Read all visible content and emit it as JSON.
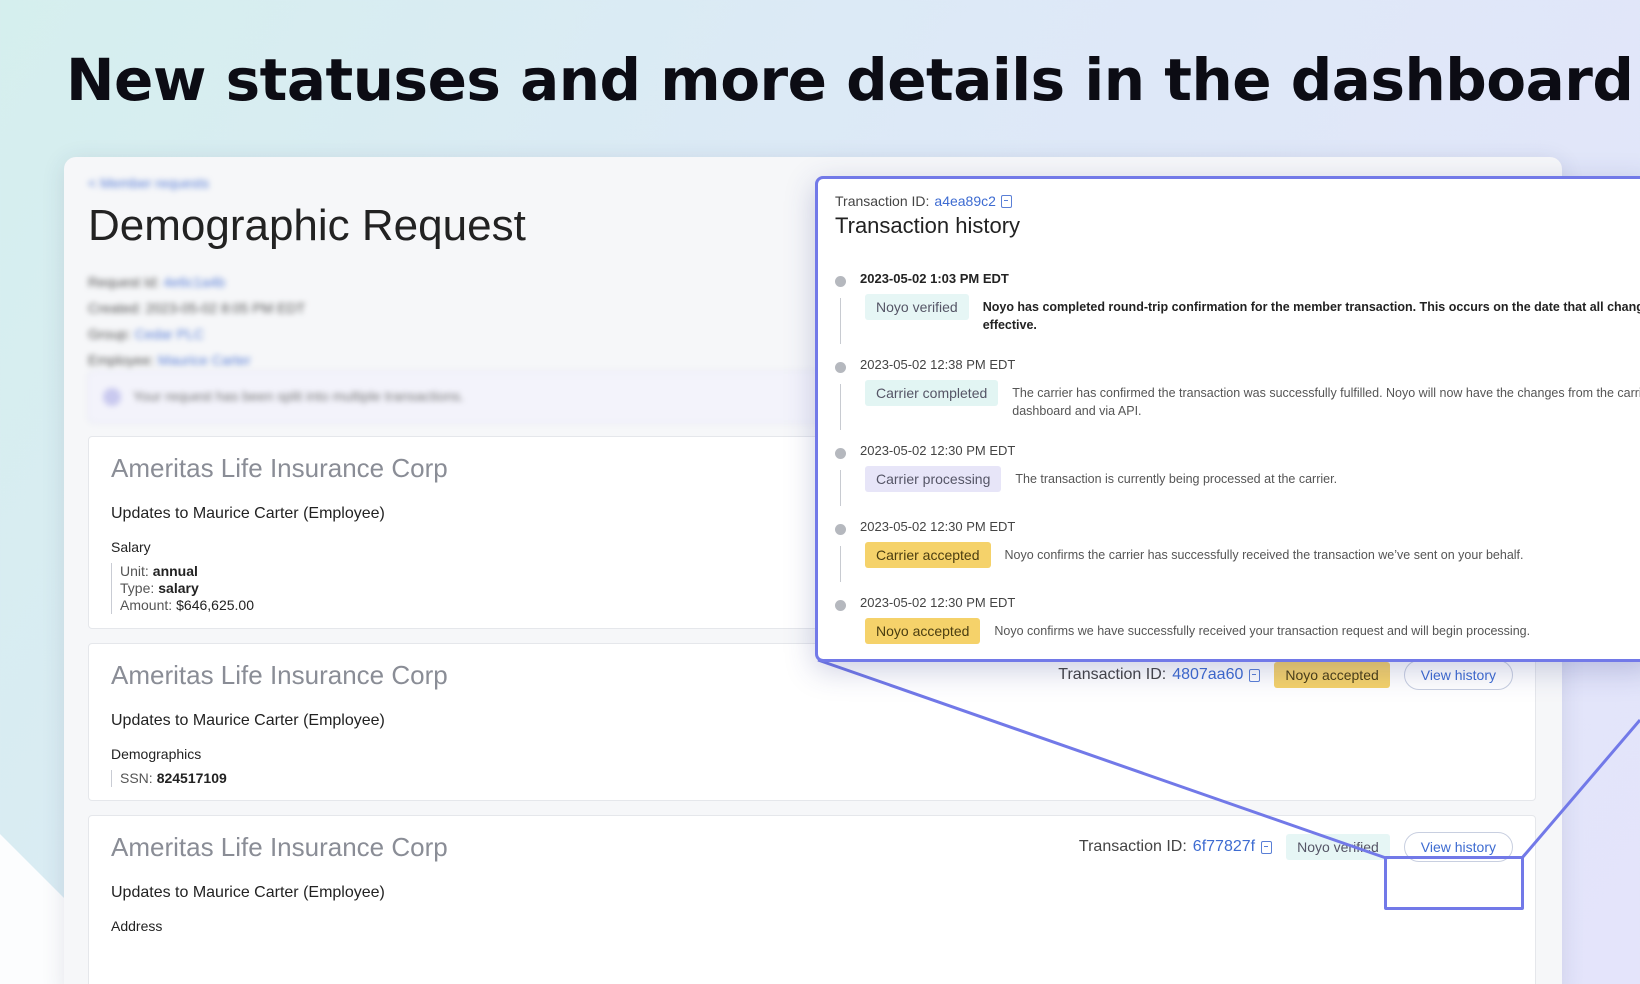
{
  "headline": "New statuses and more details in the dashboard",
  "dashboard": {
    "breadcrumb": "< Member requests",
    "page_title": "Demographic Request",
    "meta": {
      "request_id_label": "Request Id:",
      "request_id": "4e6c1a4b",
      "created_label": "Created:",
      "created": "2023-05-02 8:05 PM EDT",
      "group_label": "Group:",
      "group": "Cedar PLC",
      "employee_label": "Employee:",
      "employee": "Maurice Carter"
    },
    "notice": "Your request has been split into multiple transactions."
  },
  "panels": [
    {
      "carrier": "Ameritas Life Insurance Corp",
      "updates": "Updates to Maurice Carter (Employee)",
      "section": "Salary",
      "fields": [
        {
          "label": "Unit:",
          "value": "annual"
        },
        {
          "label": "Type:",
          "value": "salary"
        },
        {
          "label": "Amount:",
          "value": "$646,625.00"
        }
      ]
    },
    {
      "carrier": "Ameritas Life Insurance Corp",
      "updates": "Updates to Maurice Carter (Employee)",
      "section": "Demographics",
      "fields": [
        {
          "label": "SSN:",
          "value": "824517109"
        }
      ],
      "txid_label": "Transaction ID:",
      "txid": "4807aa60",
      "status": "Noyo accepted",
      "button": "View history"
    },
    {
      "carrier": "Ameritas Life Insurance Corp",
      "updates": "Updates to Maurice Carter (Employee)",
      "section": "Address",
      "txid_label": "Transaction ID:",
      "txid": "6f77827f",
      "status": "Noyo verified",
      "button": "View history"
    }
  ],
  "popup": {
    "txid_label": "Transaction ID:",
    "txid": "a4ea89c2",
    "title": "Transaction history",
    "events": [
      {
        "time": "2023-05-02 1:03 PM EDT",
        "status": "Noyo verified",
        "desc1": "Noyo has completed round-trip confirmation for the member transaction. This occurs on the date that all changes are",
        "desc2": "effective."
      },
      {
        "time": "2023-05-02 12:38 PM EDT",
        "status": "Carrier completed",
        "desc1": "The carrier has confirmed the transaction was successfully fulfilled. Noyo will now have the changes from the carrier in the",
        "desc2": "dashboard and via API."
      },
      {
        "time": "2023-05-02 12:30 PM EDT",
        "status": "Carrier processing",
        "desc1": "The transaction is currently being processed at the carrier.",
        "desc2": ""
      },
      {
        "time": "2023-05-02 12:30 PM EDT",
        "status": "Carrier accepted",
        "desc1": "Noyo confirms the carrier has successfully received the transaction we’ve sent on your behalf.",
        "desc2": ""
      },
      {
        "time": "2023-05-02 12:30 PM EDT",
        "status": "Noyo accepted",
        "desc1": "Noyo confirms we have successfully received your transaction request and will begin processing.",
        "desc2": ""
      }
    ]
  },
  "colors": {
    "accent": "#7279e8",
    "link": "#3d6bd1",
    "accepted_badge": "#f5d26a",
    "verified_badge": "#e6f6f5",
    "processing_badge": "#e7e5f8"
  }
}
